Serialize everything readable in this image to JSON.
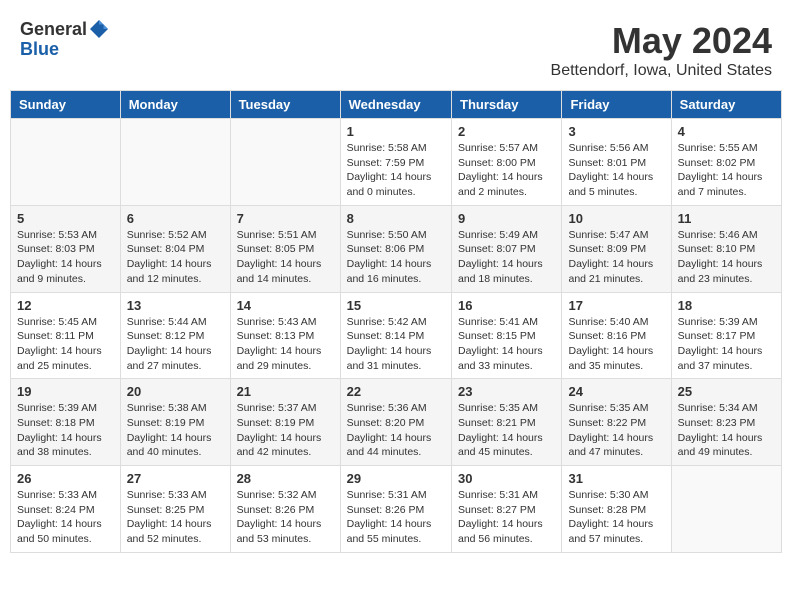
{
  "header": {
    "logo_general": "General",
    "logo_blue": "Blue",
    "month": "May 2024",
    "location": "Bettendorf, Iowa, United States"
  },
  "weekdays": [
    "Sunday",
    "Monday",
    "Tuesday",
    "Wednesday",
    "Thursday",
    "Friday",
    "Saturday"
  ],
  "weeks": [
    [
      {
        "day": "",
        "info": ""
      },
      {
        "day": "",
        "info": ""
      },
      {
        "day": "",
        "info": ""
      },
      {
        "day": "1",
        "info": "Sunrise: 5:58 AM\nSunset: 7:59 PM\nDaylight: 14 hours\nand 0 minutes."
      },
      {
        "day": "2",
        "info": "Sunrise: 5:57 AM\nSunset: 8:00 PM\nDaylight: 14 hours\nand 2 minutes."
      },
      {
        "day": "3",
        "info": "Sunrise: 5:56 AM\nSunset: 8:01 PM\nDaylight: 14 hours\nand 5 minutes."
      },
      {
        "day": "4",
        "info": "Sunrise: 5:55 AM\nSunset: 8:02 PM\nDaylight: 14 hours\nand 7 minutes."
      }
    ],
    [
      {
        "day": "5",
        "info": "Sunrise: 5:53 AM\nSunset: 8:03 PM\nDaylight: 14 hours\nand 9 minutes."
      },
      {
        "day": "6",
        "info": "Sunrise: 5:52 AM\nSunset: 8:04 PM\nDaylight: 14 hours\nand 12 minutes."
      },
      {
        "day": "7",
        "info": "Sunrise: 5:51 AM\nSunset: 8:05 PM\nDaylight: 14 hours\nand 14 minutes."
      },
      {
        "day": "8",
        "info": "Sunrise: 5:50 AM\nSunset: 8:06 PM\nDaylight: 14 hours\nand 16 minutes."
      },
      {
        "day": "9",
        "info": "Sunrise: 5:49 AM\nSunset: 8:07 PM\nDaylight: 14 hours\nand 18 minutes."
      },
      {
        "day": "10",
        "info": "Sunrise: 5:47 AM\nSunset: 8:09 PM\nDaylight: 14 hours\nand 21 minutes."
      },
      {
        "day": "11",
        "info": "Sunrise: 5:46 AM\nSunset: 8:10 PM\nDaylight: 14 hours\nand 23 minutes."
      }
    ],
    [
      {
        "day": "12",
        "info": "Sunrise: 5:45 AM\nSunset: 8:11 PM\nDaylight: 14 hours\nand 25 minutes."
      },
      {
        "day": "13",
        "info": "Sunrise: 5:44 AM\nSunset: 8:12 PM\nDaylight: 14 hours\nand 27 minutes."
      },
      {
        "day": "14",
        "info": "Sunrise: 5:43 AM\nSunset: 8:13 PM\nDaylight: 14 hours\nand 29 minutes."
      },
      {
        "day": "15",
        "info": "Sunrise: 5:42 AM\nSunset: 8:14 PM\nDaylight: 14 hours\nand 31 minutes."
      },
      {
        "day": "16",
        "info": "Sunrise: 5:41 AM\nSunset: 8:15 PM\nDaylight: 14 hours\nand 33 minutes."
      },
      {
        "day": "17",
        "info": "Sunrise: 5:40 AM\nSunset: 8:16 PM\nDaylight: 14 hours\nand 35 minutes."
      },
      {
        "day": "18",
        "info": "Sunrise: 5:39 AM\nSunset: 8:17 PM\nDaylight: 14 hours\nand 37 minutes."
      }
    ],
    [
      {
        "day": "19",
        "info": "Sunrise: 5:39 AM\nSunset: 8:18 PM\nDaylight: 14 hours\nand 38 minutes."
      },
      {
        "day": "20",
        "info": "Sunrise: 5:38 AM\nSunset: 8:19 PM\nDaylight: 14 hours\nand 40 minutes."
      },
      {
        "day": "21",
        "info": "Sunrise: 5:37 AM\nSunset: 8:19 PM\nDaylight: 14 hours\nand 42 minutes."
      },
      {
        "day": "22",
        "info": "Sunrise: 5:36 AM\nSunset: 8:20 PM\nDaylight: 14 hours\nand 44 minutes."
      },
      {
        "day": "23",
        "info": "Sunrise: 5:35 AM\nSunset: 8:21 PM\nDaylight: 14 hours\nand 45 minutes."
      },
      {
        "day": "24",
        "info": "Sunrise: 5:35 AM\nSunset: 8:22 PM\nDaylight: 14 hours\nand 47 minutes."
      },
      {
        "day": "25",
        "info": "Sunrise: 5:34 AM\nSunset: 8:23 PM\nDaylight: 14 hours\nand 49 minutes."
      }
    ],
    [
      {
        "day": "26",
        "info": "Sunrise: 5:33 AM\nSunset: 8:24 PM\nDaylight: 14 hours\nand 50 minutes."
      },
      {
        "day": "27",
        "info": "Sunrise: 5:33 AM\nSunset: 8:25 PM\nDaylight: 14 hours\nand 52 minutes."
      },
      {
        "day": "28",
        "info": "Sunrise: 5:32 AM\nSunset: 8:26 PM\nDaylight: 14 hours\nand 53 minutes."
      },
      {
        "day": "29",
        "info": "Sunrise: 5:31 AM\nSunset: 8:26 PM\nDaylight: 14 hours\nand 55 minutes."
      },
      {
        "day": "30",
        "info": "Sunrise: 5:31 AM\nSunset: 8:27 PM\nDaylight: 14 hours\nand 56 minutes."
      },
      {
        "day": "31",
        "info": "Sunrise: 5:30 AM\nSunset: 8:28 PM\nDaylight: 14 hours\nand 57 minutes."
      },
      {
        "day": "",
        "info": ""
      }
    ]
  ]
}
